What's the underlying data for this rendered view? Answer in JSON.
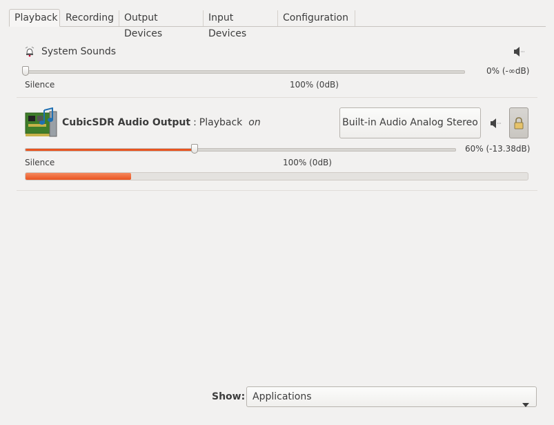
{
  "tabs": [
    {
      "label": "Playback",
      "active": true
    },
    {
      "label": "Recording"
    },
    {
      "label": "Output Devices"
    },
    {
      "label": "Input Devices"
    },
    {
      "label": "Configuration"
    }
  ],
  "system_sounds": {
    "name": "System Sounds",
    "icon": "bell-icon",
    "volume_text": "0% (-∞dB)",
    "volume_percent": 0,
    "silence_label": "Silence",
    "hundred_label": "100% (0dB)",
    "muted_icon": "speaker-muted-icon"
  },
  "stream": {
    "app_name": "CubicSDR Audio Output",
    "separator": ":",
    "role": "Playback",
    "status": "on",
    "icon": "soundcard-icon",
    "device_label": "Built-in Audio Analog Stereo",
    "volume_text": "60% (-13.38dB)",
    "volume_percent": 60,
    "silence_label": "Silence",
    "hundred_label": "100% (0dB)",
    "peak_level_percent": 21,
    "muted_icon": "speaker-muted-icon",
    "lock_icon": "lock-icon"
  },
  "footer": {
    "show_label": "Show:",
    "show_value": "Applications"
  },
  "colors": {
    "accent": "#e95420",
    "background": "#f2f1f0"
  }
}
